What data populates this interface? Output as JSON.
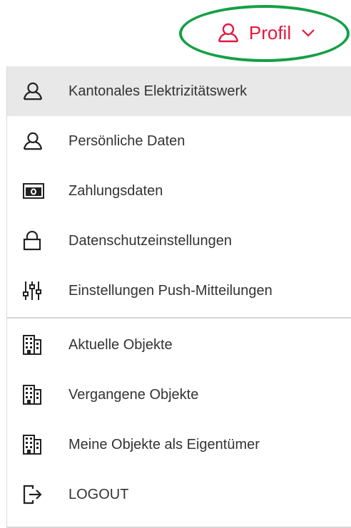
{
  "header": {
    "profile_label": "Profil"
  },
  "colors": {
    "accent": "#e5173f",
    "highlight": "#14a046",
    "active_bg": "#e8e8e8",
    "text": "#333333"
  },
  "menu": {
    "group_account": [
      {
        "label": "Kantonales Elektrizitätswerk",
        "icon": "user-icon",
        "active": true
      },
      {
        "label": "Persönliche Daten",
        "icon": "user-icon"
      },
      {
        "label": "Zahlungsdaten",
        "icon": "banknote-icon"
      },
      {
        "label": "Datenschutzeinstellungen",
        "icon": "lock-icon"
      },
      {
        "label": "Einstellungen Push-Mitteilungen",
        "icon": "sliders-icon"
      }
    ],
    "group_objects": [
      {
        "label": "Aktuelle Objekte",
        "icon": "building-icon"
      },
      {
        "label": "Vergangene Objekte",
        "icon": "building-icon"
      },
      {
        "label": "Meine Objekte als Eigentümer",
        "icon": "building-icon"
      },
      {
        "label": "LOGOUT",
        "icon": "logout-icon"
      }
    ]
  }
}
